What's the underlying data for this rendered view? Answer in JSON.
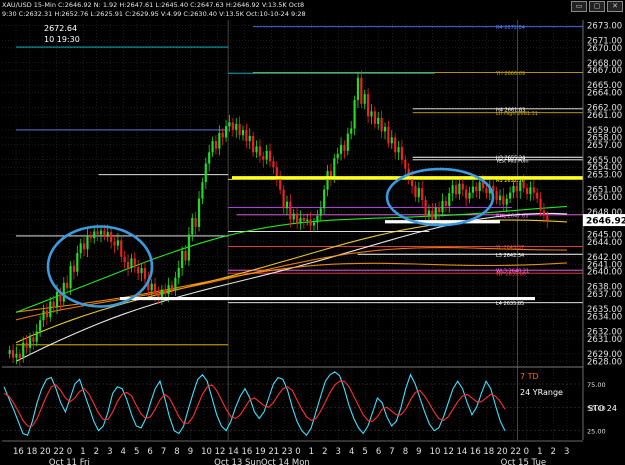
{
  "header": {
    "title": "XAU/USD 15-Min",
    "ohlc_line": "C:2646.92  N: 1.92  H:2647.61  L:2645.40  C:2647.63  H:2646.92  V:13.5K  Oct8",
    "info_line": "9:30  C:2632.31  H:2652.76  L:2625.91  C:2629.95  V:4.99  C:2630.40  V:13.5K  Oct:10-10-24  9:28",
    "window_buttons": [
      "▭",
      "▢",
      "✕"
    ]
  },
  "crosshair_readout": {
    "price": "2672.64",
    "time": "10 19:30"
  },
  "panel_labels": {
    "td": "7 TD",
    "yrange": "24 YRange",
    "sto": "STO  24"
  },
  "colors": {
    "background": "#000000",
    "grid": "#3a3a3a",
    "candle_up": "#22dd22",
    "candle_down": "#ee2222",
    "ellipse": "#3a9be0",
    "support_white": "#ffffff",
    "resistance_yellow": "#ffff22",
    "stoch_k": "#40e0ff",
    "stoch_d": "#ff3030"
  },
  "chart_data": [
    {
      "type": "candlestick",
      "title": "XAU/USD 15-Min",
      "ylim": [
        2627.5,
        2674
      ],
      "yticks": [
        2628.0,
        2629.0,
        2631.0,
        2632.0,
        2634.0,
        2635.0,
        2637.0,
        2638.0,
        2640.0,
        2641.0,
        2642.0,
        2644.0,
        2645.0,
        2647.0,
        2648.0,
        2650.0,
        2651.0,
        2653.0,
        2654.0,
        2655.0,
        2657.0,
        2658.0,
        2659.0,
        2661.0,
        2662.0,
        2664.0,
        2665.0,
        2667.0,
        2668.0,
        2670.0,
        2671.0,
        2673.0
      ],
      "ytick_labels": [
        "2628.00",
        "2629.00",
        "2631.00",
        "2632.00",
        "2634.00",
        "2635.00",
        "2637.00",
        "2638.00",
        "2640.00",
        "2641.00",
        "2642.00",
        "2644.00",
        "2645.00",
        "2647.00",
        "2648.00",
        "2650.00",
        "2651.00",
        "2653.00",
        "2654.00",
        "2655.00",
        "2657.00",
        "2658.00",
        "2659.00",
        "2661.00",
        "2662.00",
        "2664.00",
        "2665.00",
        "2667.00",
        "2668.00",
        "2670.00",
        "2671.00",
        "2673.00"
      ],
      "last_price": 2646.92,
      "last_price_label": "2646.92",
      "xticks": [
        "16",
        "18",
        "20",
        "22",
        "0",
        "1",
        "2",
        "3",
        "4",
        "5",
        "6",
        "7",
        "8",
        "9",
        "10",
        "12",
        "14",
        "16",
        "19",
        "21",
        "23",
        "0",
        "1",
        "2",
        "3",
        "4",
        "5",
        "6",
        "7",
        "8",
        "9",
        "10",
        "12",
        "14",
        "16",
        "18",
        "20",
        "22",
        "0",
        "1",
        "2",
        "3"
      ],
      "date_labels": [
        "Oct 11 Fri",
        "Oct 13 Sun",
        "Oct 14 Mon",
        "Oct 15 Tue"
      ],
      "closes": [
        2629.5,
        2628.5,
        2629.0,
        2628.4,
        2630.5,
        2629.8,
        2631.2,
        2630.6,
        2632.0,
        2633.5,
        2634.8,
        2633.9,
        2636.0,
        2635.2,
        2637.3,
        2636.0,
        2638.5,
        2637.8,
        2640.8,
        2640.0,
        2642.5,
        2643.8,
        2643.0,
        2644.8,
        2644.5,
        2645.4,
        2645.0,
        2645.5,
        2644.8,
        2645.3,
        2644.0,
        2643.5,
        2644.2,
        2642.0,
        2641.3,
        2640.5,
        2641.8,
        2640.6,
        2639.8,
        2640.5,
        2639.0,
        2637.5,
        2638.4,
        2637.0,
        2636.3,
        2637.6,
        2637.0,
        2638.2,
        2637.5,
        2639.2,
        2640.5,
        2642.8,
        2641.5,
        2645.0,
        2647.2,
        2646.0,
        2649.8,
        2652.0,
        2654.5,
        2656.0,
        2657.5,
        2656.5,
        2658.6,
        2658.0,
        2659.5,
        2660.0,
        2659.0,
        2659.8,
        2658.3,
        2659.0,
        2657.5,
        2658.2,
        2656.0,
        2656.8,
        2655.5,
        2655.0,
        2656.2,
        2654.8,
        2654.0,
        2652.5,
        2651.0,
        2648.5,
        2649.4,
        2647.0,
        2647.8,
        2646.5,
        2647.2,
        2646.8,
        2647.0,
        2646.2,
        2646.6,
        2647.5,
        2648.5,
        2651.0,
        2653.5,
        2652.5,
        2655.2,
        2655.8,
        2657.0,
        2656.2,
        2658.5,
        2659.2,
        2663.0,
        2666.0,
        2662.5,
        2663.8,
        2660.8,
        2661.5,
        2659.8,
        2660.6,
        2658.8,
        2659.4,
        2657.2,
        2658.0,
        2656.0,
        2656.7,
        2655.0,
        2653.8,
        2652.6,
        2651.5,
        2650.0,
        2651.2,
        2649.6,
        2647.5,
        2648.2,
        2647.0,
        2648.6,
        2648.0,
        2649.5,
        2648.8,
        2650.5,
        2651.6,
        2650.4,
        2651.8,
        2651.0,
        2649.8,
        2650.6,
        2651.4,
        2650.8,
        2652.0,
        2651.2,
        2650.5,
        2651.5,
        2650.8,
        2649.6,
        2650.2,
        2649.0,
        2649.8,
        2650.6,
        2651.5,
        2650.8,
        2652.0,
        2651.2,
        2650.4,
        2651.3,
        2650.6,
        2649.8,
        2648.2,
        2647.5,
        2646.9
      ],
      "horizontal_levels": [
        {
          "label": "R4  2672.84",
          "value": 2672.84,
          "color": "#5577ff"
        },
        {
          "label": "YH  2666.69",
          "value": 2666.69,
          "color": "#ccaa00"
        },
        {
          "label": "H4  2661.83",
          "value": 2661.83,
          "color": "#ffffff"
        },
        {
          "label": "LH High  2661.31",
          "value": 2661.31,
          "color": "#ccaa00"
        },
        {
          "label": "H3  2655.34",
          "value": 2655.34,
          "color": "#ffffff"
        },
        {
          "label": "Yest Mid Poin",
          "value": 2655.0,
          "color": "#ffffff"
        },
        {
          "label": "R3  2652.38",
          "value": 2652.38,
          "color": "#ffff22"
        },
        {
          "label": "RHL  2647.63",
          "value": 2647.63,
          "color": "#ff66ff"
        },
        {
          "label": "YL  2643.37",
          "value": 2643.37,
          "color": "#ff4444"
        },
        {
          "label": "L3  2642.34",
          "value": 2642.34,
          "color": "#ffffff"
        },
        {
          "label": "WL3  2640.21",
          "value": 2640.21,
          "color": "#ff66ff"
        },
        {
          "label": "WF  2639.80",
          "value": 2639.8,
          "color": "#ff4444"
        },
        {
          "label": "L4  2635.85",
          "value": 2635.85,
          "color": "#ffffff"
        }
      ],
      "moving_averages": [
        {
          "name": "",
          "color": "#ffffff",
          "start": 2628.0,
          "end": 2647.5
        },
        {
          "name": "",
          "color": "#ffdd33",
          "start": 2630.0,
          "end": 2647.0
        },
        {
          "name": "",
          "color": "#ff8800",
          "start": 2633.0,
          "end": 2643.5
        },
        {
          "name": "",
          "color": "#ff9900",
          "start": 2634.5,
          "end": 2641.5
        },
        {
          "name": "",
          "color": "#22ff22",
          "start": 2635.0,
          "end": 2648.5
        }
      ]
    },
    {
      "type": "line",
      "title": "",
      "ylim": [
        15,
        90
      ],
      "yticks": [
        25,
        50,
        75
      ],
      "ytick_labels": [
        "25.00",
        "50.00",
        "75.00"
      ],
      "series": [
        {
          "name": "",
          "color": "#40e0ff",
          "values": [
            72,
            60,
            48,
            35,
            22,
            20,
            35,
            55,
            70,
            80,
            82,
            70,
            55,
            45,
            60,
            75,
            80,
            65,
            50,
            35,
            25,
            30,
            45,
            65,
            72,
            70,
            58,
            42,
            30,
            28,
            38,
            55,
            70,
            78,
            60,
            40,
            25,
            22,
            30,
            48,
            65,
            80,
            85,
            78,
            60,
            42,
            30,
            25,
            35,
            50,
            62,
            70,
            60,
            45,
            38,
            45,
            60,
            75,
            82,
            80,
            68,
            50,
            35,
            25,
            20,
            28,
            45,
            62,
            78,
            85,
            88,
            84,
            70,
            52,
            38,
            28,
            22,
            30,
            45,
            60,
            55,
            40,
            30,
            35,
            50,
            70,
            85,
            75,
            60,
            45,
            32,
            25,
            28,
            40,
            55,
            70,
            78,
            70,
            55,
            42,
            50,
            65,
            78,
            70,
            52,
            35,
            25
          ]
        },
        {
          "name": "",
          "color": "#ff3030",
          "values": [
            65,
            62,
            55,
            46,
            36,
            30,
            30,
            38,
            50,
            62,
            72,
            74,
            68,
            60,
            56,
            60,
            67,
            70,
            64,
            54,
            44,
            37,
            37,
            45,
            56,
            64,
            66,
            62,
            52,
            43,
            38,
            40,
            48,
            58,
            64,
            60,
            50,
            40,
            33,
            33,
            40,
            52,
            64,
            72,
            74,
            68,
            58,
            48,
            40,
            38,
            42,
            50,
            58,
            60,
            56,
            52,
            50,
            55,
            63,
            70,
            72,
            68,
            58,
            48,
            40,
            36,
            38,
            46,
            56,
            66,
            74,
            78,
            78,
            72,
            62,
            52,
            42,
            36,
            35,
            40,
            48,
            50,
            46,
            42,
            42,
            48,
            58,
            66,
            68,
            62,
            54,
            45,
            38,
            36,
            40,
            48,
            56,
            62,
            64,
            60,
            56,
            56,
            60,
            64,
            62,
            56,
            48
          ]
        }
      ]
    }
  ]
}
